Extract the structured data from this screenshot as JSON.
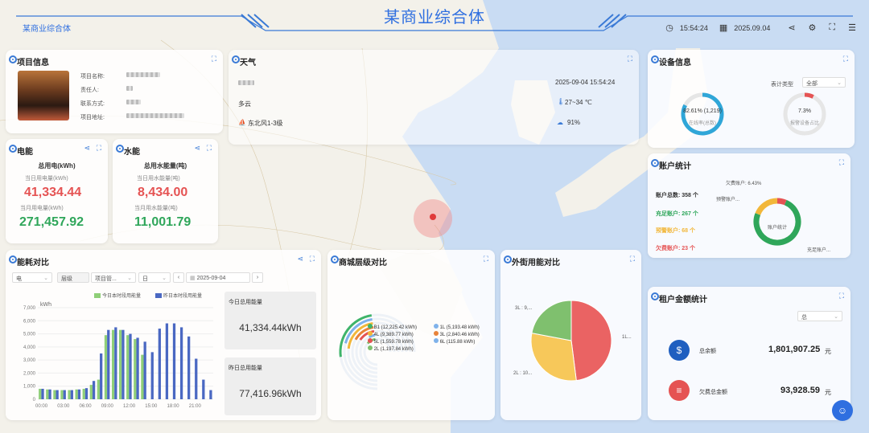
{
  "header": {
    "title": "某商业综合体",
    "logo_text": "某商业综合体",
    "time": "15:54:24",
    "date": "2025.09.04"
  },
  "project": {
    "title": "项目信息",
    "fields": [
      "项目名称:",
      "责任人:",
      "联系方式:",
      "项目地址:"
    ]
  },
  "weather": {
    "title": "天气",
    "condition": "多云",
    "wind": "东北风1-3级",
    "datetime": "2025-09-04 15:54:24",
    "temp": "27~34 ℃",
    "humidity": "91%"
  },
  "device": {
    "title": "设备信息",
    "meter_type_label": "表计类型",
    "meter_type_value": "全部",
    "gauge1_value": "82.61% (1,219)",
    "gauge1_label": "在线率(总数)",
    "gauge1_pct": 82.61,
    "gauge2_value": "7.3%",
    "gauge2_label": "报警设备占比",
    "gauge2_pct": 7.3
  },
  "electric": {
    "title": "电能",
    "heading": "总用电(kWh)",
    "today_label": "当日用电量(kWh)",
    "today_value": "41,334.44",
    "month_label": "当月用电量(kWh)",
    "month_value": "271,457.92"
  },
  "water": {
    "title": "水能",
    "heading": "总用水能量(吨)",
    "today_label": "当日用水能量(吨)",
    "today_value": "8,434.00",
    "month_label": "当月用水能量(吨)",
    "month_value": "11,001.79"
  },
  "account": {
    "title": "账户统计",
    "total": "账户总数: 358 个",
    "charged": "充足账户: 267 个",
    "warning": "预警账户: 68 个",
    "arrears": "欠费账户: 23 个",
    "arrears_pct": "欠费账户: 6.43%",
    "warning_short": "预警账户...",
    "charged_short": "充足账户...",
    "center": "账户统计",
    "values": [
      267,
      68,
      23
    ],
    "colors": [
      "#2fa65a",
      "#f2b73a",
      "#e55353"
    ]
  },
  "energy_compare": {
    "title": "能耗对比",
    "sel_type": "电",
    "sel_level": "层级",
    "sel_item": "项目管...",
    "sel_period": "日",
    "date": "2025-09-04",
    "legend_today": "今日本时段用能量",
    "legend_yesterday": "昨日本时段用能量",
    "unit": "kWh",
    "today_total_label": "今日总用能量",
    "today_total": "41,334.44kWh",
    "yesterday_total_label": "昨日总用能量",
    "yesterday_total": "77,416.96kWh"
  },
  "floor_compare": {
    "title": "商城层级对比",
    "items": [
      {
        "label": "B1 (12,225.42 kWh)",
        "color": "#3fb46a"
      },
      {
        "label": "1L (5,193.48 kWh)",
        "color": "#7fb2ea"
      },
      {
        "label": "4L (9,389.77 kWh)",
        "color": "#f2b73a"
      },
      {
        "label": "3L (2,840.46 kWh)",
        "color": "#e8833a"
      },
      {
        "label": "5L (1,559.78 kWh)",
        "color": "#e55353"
      },
      {
        "label": "6L (115.88 kWh)",
        "color": "#7fb2ea"
      },
      {
        "label": "2L (1,197.84 kWh)",
        "color": "#7fc06e"
      }
    ]
  },
  "street_compare": {
    "title": "外街用能对比",
    "label_1l": "1L...",
    "label_2l": "2L : 10...",
    "label_3l": "3L : 9,...",
    "values": [
      48,
      30,
      22
    ],
    "colors": [
      "#ea6363",
      "#f7c85a",
      "#7fc06e"
    ]
  },
  "tenant": {
    "title": "租户金额统计",
    "sel": "总",
    "balance_label": "总余额",
    "balance_value": "1,801,907.25",
    "balance_unit": "元",
    "arrears_label": "欠费总金额",
    "arrears_value": "93,928.59",
    "arrears_unit": "元"
  },
  "chart_data": {
    "type": "bar",
    "x": [
      "00:00",
      "01:00",
      "02:00",
      "03:00",
      "04:00",
      "05:00",
      "06:00",
      "07:00",
      "08:00",
      "09:00",
      "10:00",
      "11:00",
      "12:00",
      "13:00",
      "14:00",
      "15:00",
      "16:00",
      "17:00",
      "18:00",
      "19:00",
      "20:00",
      "21:00",
      "22:00",
      "23:00"
    ],
    "xticks": [
      "00:00",
      "03:00",
      "06:00",
      "09:00",
      "12:00",
      "15:00",
      "18:00",
      "21:00"
    ],
    "yticks": [
      "0",
      "1,000",
      "2,000",
      "3,000",
      "4,000",
      "5,000",
      "6,000",
      "7,000"
    ],
    "ylabel": "kWh",
    "ylim": [
      0,
      7000
    ],
    "series": [
      {
        "name": "今日本时段用能量",
        "color": "#8fcf78",
        "values": [
          800,
          750,
          700,
          700,
          700,
          750,
          800,
          1100,
          1500,
          4900,
          5300,
          5300,
          4900,
          4600,
          3400,
          0,
          0,
          0,
          0,
          0,
          0,
          0,
          0,
          0
        ]
      },
      {
        "name": "昨日本时段用能量",
        "color": "#4a68c2",
        "values": [
          800,
          750,
          700,
          700,
          700,
          750,
          850,
          1400,
          3500,
          5300,
          5500,
          5300,
          5000,
          4700,
          4400,
          3600,
          5400,
          5800,
          5800,
          5500,
          4800,
          3100,
          1500,
          700
        ]
      }
    ]
  }
}
